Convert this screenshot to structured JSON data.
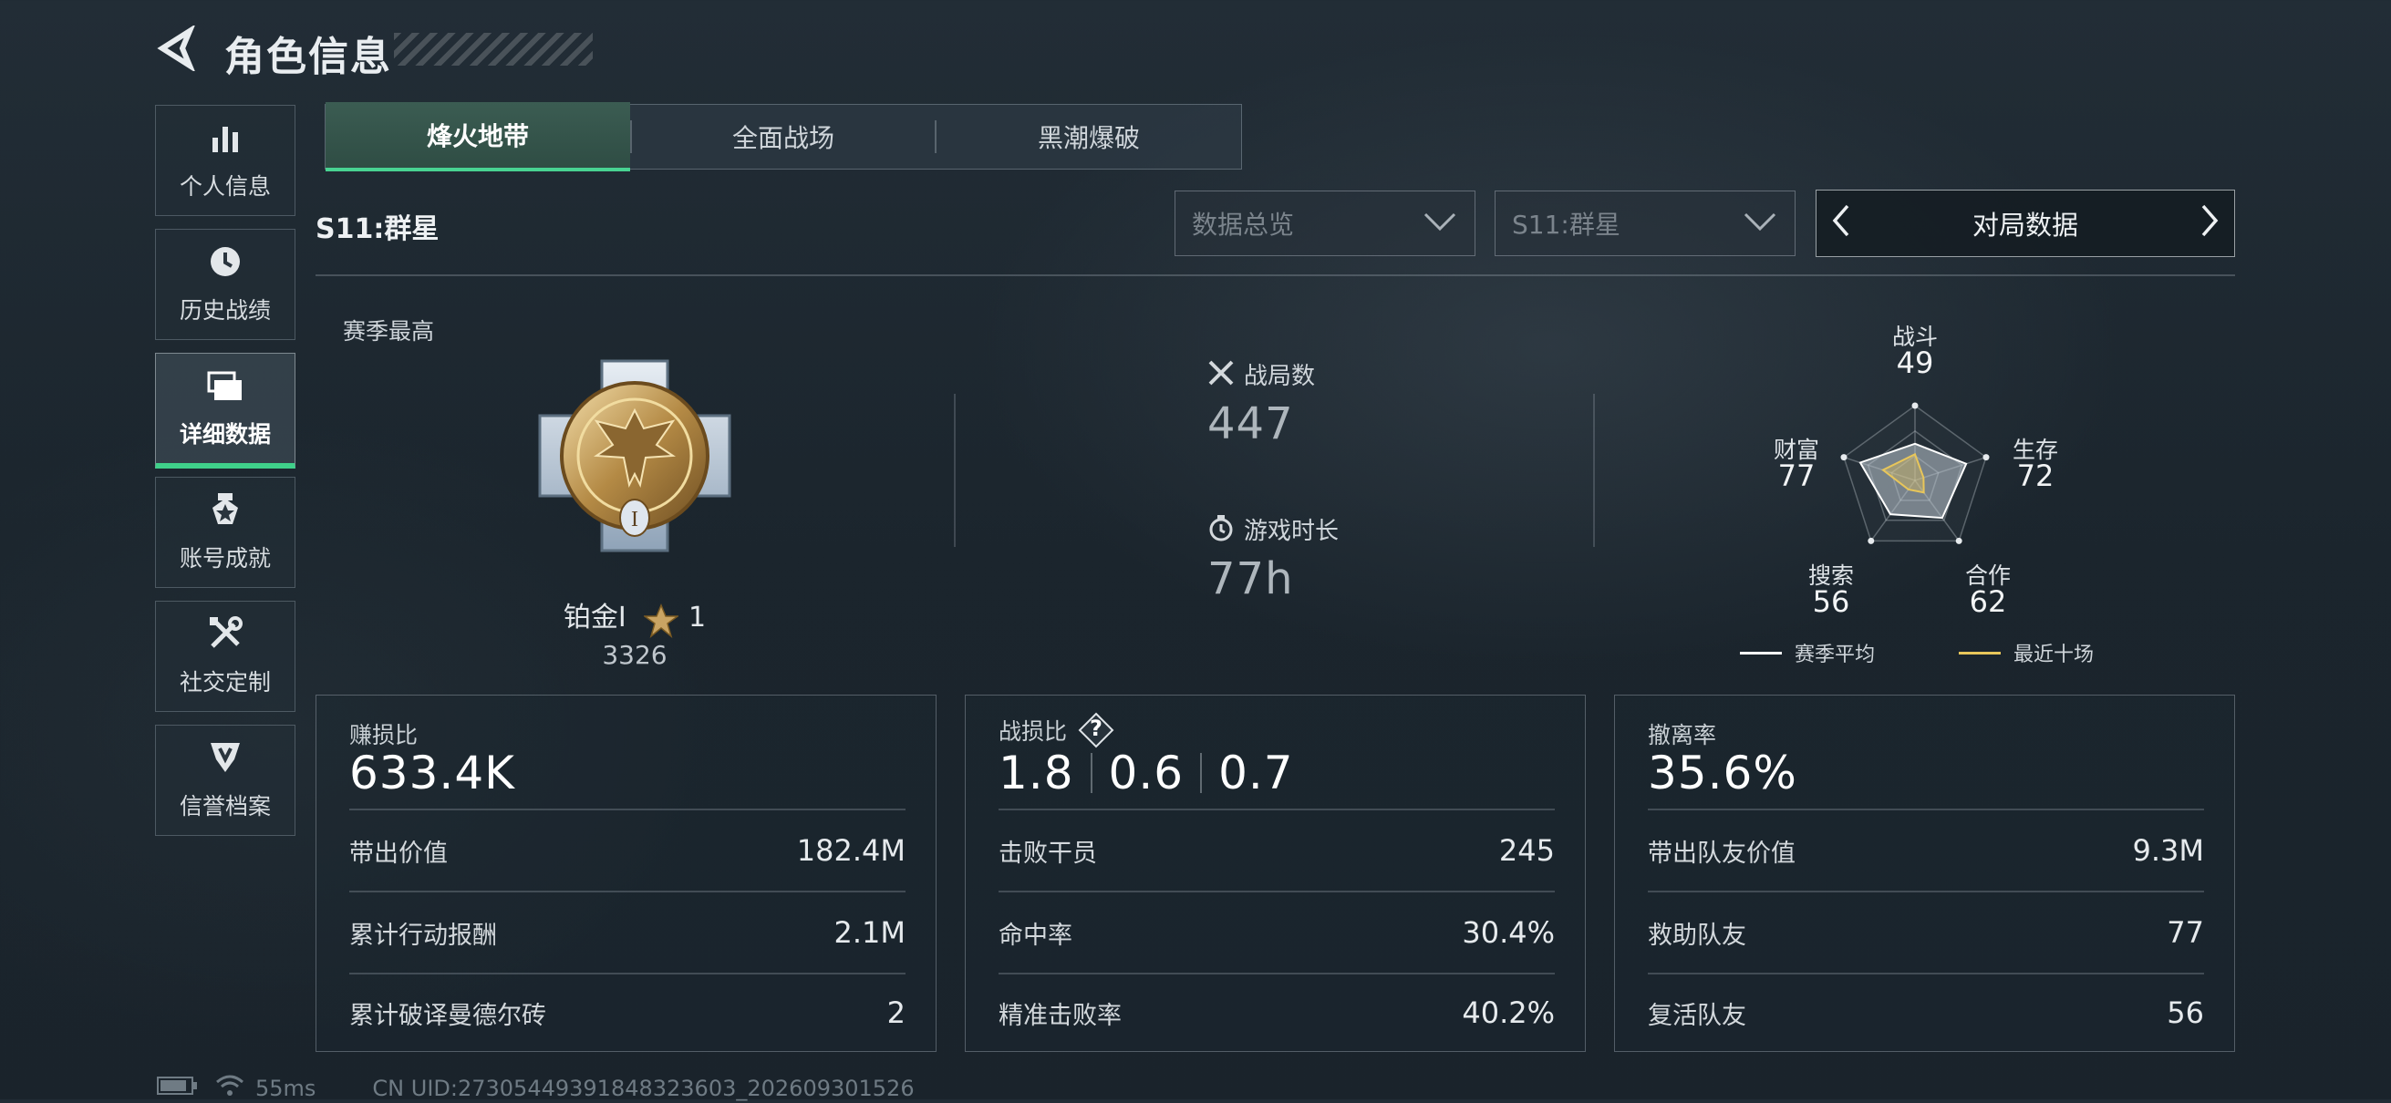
{
  "header": {
    "title": "角色信息"
  },
  "sidebar": {
    "items": [
      {
        "label": "个人信息",
        "icon": "bar-chart-icon"
      },
      {
        "label": "历史战绩",
        "icon": "clock-icon"
      },
      {
        "label": "详细数据",
        "icon": "folder-icon",
        "active": true
      },
      {
        "label": "账号成就",
        "icon": "medal-icon"
      },
      {
        "label": "社交定制",
        "icon": "tools-icon"
      },
      {
        "label": "信誉档案",
        "icon": "shield-badge-icon"
      }
    ]
  },
  "tabs": [
    {
      "label": "烽火地带",
      "active": true
    },
    {
      "label": "全面战场"
    },
    {
      "label": "黑潮爆破"
    }
  ],
  "season": {
    "title": "S11:群星"
  },
  "filters": {
    "dropdown1": "数据总览",
    "dropdown2": "S11:群星",
    "selector": "对局数据"
  },
  "rank": {
    "caption": "赛季最高",
    "name": "铂金Ⅰ",
    "stars": "1",
    "score": "3326",
    "badge_numeral": "I"
  },
  "overview": {
    "matches_label": "战局数",
    "matches_value": "447",
    "time_label": "游戏时长",
    "time_value": "77h"
  },
  "radar": {
    "axes": [
      {
        "label": "战斗",
        "value": "49"
      },
      {
        "label": "生存",
        "value": "72"
      },
      {
        "label": "合作",
        "value": "62"
      },
      {
        "label": "搜索",
        "value": "56"
      },
      {
        "label": "财富",
        "value": "77"
      }
    ],
    "season_avg_norm": [
      0.49,
      0.72,
      0.62,
      0.56,
      0.77
    ],
    "recent_ten_norm": [
      0.35,
      0.12,
      0.2,
      0.15,
      0.45
    ],
    "legend_avg": "赛季平均",
    "legend_recent": "最近十场",
    "color_avg": "#ffffff",
    "color_recent": "#e8c65a"
  },
  "cards": [
    {
      "label": "赚损比",
      "big": "633.4K",
      "rows": [
        {
          "label": "带出价值",
          "value": "182.4M"
        },
        {
          "label": "累计行动报酬",
          "value": "2.1M"
        },
        {
          "label": "累计破译曼德尔砖",
          "value": "2"
        }
      ]
    },
    {
      "label": "战损比",
      "help": "?",
      "big_parts": [
        "1.8",
        "0.6",
        "0.7"
      ],
      "rows": [
        {
          "label": "击败干员",
          "value": "245"
        },
        {
          "label": "命中率",
          "value": "30.4%"
        },
        {
          "label": "精准击败率",
          "value": "40.2%"
        }
      ]
    },
    {
      "label": "撤离率",
      "big": "35.6%",
      "rows": [
        {
          "label": "带出队友价值",
          "value": "9.3M"
        },
        {
          "label": "救助队友",
          "value": "77"
        },
        {
          "label": "复活队友",
          "value": "56"
        }
      ]
    }
  ],
  "footer": {
    "ping": "55ms",
    "uid": "CN UID:2730544939184832360­3_202609301526"
  },
  "colors": {
    "accent": "#3fd08a",
    "background": "#1b252d"
  }
}
